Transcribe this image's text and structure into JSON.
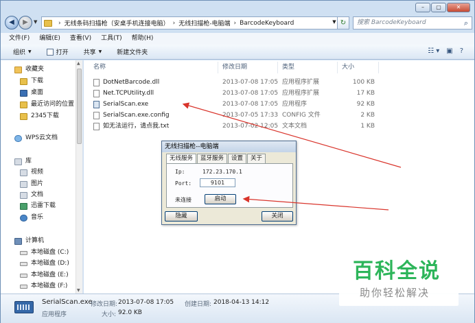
{
  "window": {
    "caption_buttons": [
      "–",
      "▢",
      "✕"
    ]
  },
  "address": {
    "crumbs": [
      "无线条码扫描枪（安桌手机连接电脑）",
      "无线扫描枪-电脑端",
      "BarcodeKeyboard"
    ],
    "search_placeholder": "搜索 BarcodeKeyboard"
  },
  "menubar": {
    "items": [
      "文件(F)",
      "编辑(E)",
      "查看(V)",
      "工具(T)",
      "帮助(H)"
    ]
  },
  "cmdbar": {
    "organize": "组织",
    "open": "打开",
    "share": "共享",
    "new_folder": "新建文件夹"
  },
  "navpane": {
    "favorites": "收藏夹",
    "fav_items": [
      "下载",
      "桌面",
      "最近访问的位置",
      "2345下载"
    ],
    "wps": "WPS云文档",
    "library": "库",
    "lib_items": [
      "视频",
      "图片",
      "文档",
      "迅雷下载",
      "音乐"
    ],
    "computer": "计算机",
    "drives": [
      "本地磁盘 (C:)",
      "本地磁盘 (D:)",
      "本地磁盘 (E:)",
      "本地磁盘 (F:)"
    ]
  },
  "filelist": {
    "columns": [
      "名称",
      "修改日期",
      "类型",
      "大小"
    ],
    "rows": [
      {
        "name": "DotNetBarcode.dll",
        "date": "2013-07-08 17:05",
        "type": "应用程序扩展",
        "size": "100 KB"
      },
      {
        "name": "Net.TCPUtility.dll",
        "date": "2013-07-08 17:05",
        "type": "应用程序扩展",
        "size": "17 KB"
      },
      {
        "name": "SerialScan.exe",
        "date": "2013-07-08 17:05",
        "type": "应用程序",
        "size": "92 KB"
      },
      {
        "name": "SerialScan.exe.config",
        "date": "2013-07-05 17:33",
        "type": "CONFIG 文件",
        "size": "2 KB"
      },
      {
        "name": "如无法运行，请点我.txt",
        "date": "2013-07-02 12:05",
        "type": "文本文档",
        "size": "1 KB"
      }
    ]
  },
  "details": {
    "name": "SerialScan.exe",
    "modified_label": "修改日期:",
    "modified_value": "2013-07-08 17:05",
    "created_label": "创建日期:",
    "created_value": "2018-04-13 14:12",
    "type": "应用程序",
    "size_label": "大小:",
    "size_value": "92.0 KB"
  },
  "dialog": {
    "title": "无线扫描枪--电脑端",
    "tabs": [
      "无线服务",
      "蓝牙服务",
      "设置",
      "关于"
    ],
    "ip_label": "Ip:",
    "ip_value": "172.23.170.1",
    "port_label": "Port:",
    "port_value": "9101",
    "status": "未连接",
    "start_button": "启动",
    "hide_button": "隐藏",
    "close_button": "关闭"
  },
  "watermark": {
    "title": "百科全说",
    "subtitle": "助你轻松解决"
  },
  "colors": {
    "annotation_arrow": "#d9342b",
    "watermark_green": "#2db55a"
  }
}
